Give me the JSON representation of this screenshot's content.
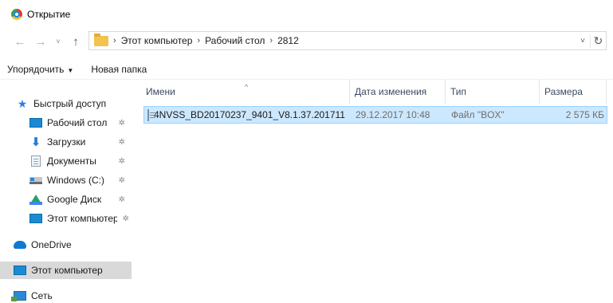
{
  "window": {
    "title": "Открытие"
  },
  "navigation": {
    "back": "←",
    "forward": "→",
    "recent": "˅",
    "up": "↑",
    "breadcrumb": [
      "Этот компьютер",
      "Рабочий стол",
      "2812"
    ],
    "separator": "›",
    "dropdown": "˅",
    "refresh": "↻"
  },
  "toolbar": {
    "organize_label": "Упорядочить",
    "organize_caret": "▼",
    "new_folder_label": "Новая папка"
  },
  "sidebar": {
    "pin_glyph": "✲",
    "items": [
      {
        "label": "Быстрый доступ",
        "icon": "star-icon",
        "pinned": false
      },
      {
        "label": "Рабочий стол",
        "icon": "desktop-icon",
        "pinned": true
      },
      {
        "label": "Загрузки",
        "icon": "download-icon",
        "pinned": true
      },
      {
        "label": "Документы",
        "icon": "documents-icon",
        "pinned": true
      },
      {
        "label": "Windows (C:)",
        "icon": "drive-icon",
        "pinned": true
      },
      {
        "label": "Google Диск",
        "icon": "google-drive-icon",
        "pinned": true
      },
      {
        "label": "Этот компьютер",
        "icon": "computer-icon",
        "pinned": true
      },
      {
        "label": "OneDrive",
        "icon": "onedrive-icon",
        "pinned": false
      },
      {
        "label": "Этот компьютер",
        "icon": "computer-icon",
        "pinned": false,
        "selected": true
      },
      {
        "label": "Сеть",
        "icon": "network-icon",
        "pinned": false
      }
    ]
  },
  "columns": {
    "name": "Имени",
    "date": "Дата изменения",
    "type": "Тип",
    "size": "Размера",
    "sort_indicator": "^"
  },
  "files": [
    {
      "name": "4NVSS_BD20170237_9401_V8.1.37.201711...",
      "date": "29.12.2017 10:48",
      "type": "Файл \"BOX\"",
      "size": "2 575 КБ",
      "selected": true
    }
  ],
  "colors": {
    "selection_bg": "#cce8ff",
    "selection_border": "#99d1ff",
    "sidebar_selected": "#d9d9d9",
    "header_text": "#3a4a5f"
  }
}
